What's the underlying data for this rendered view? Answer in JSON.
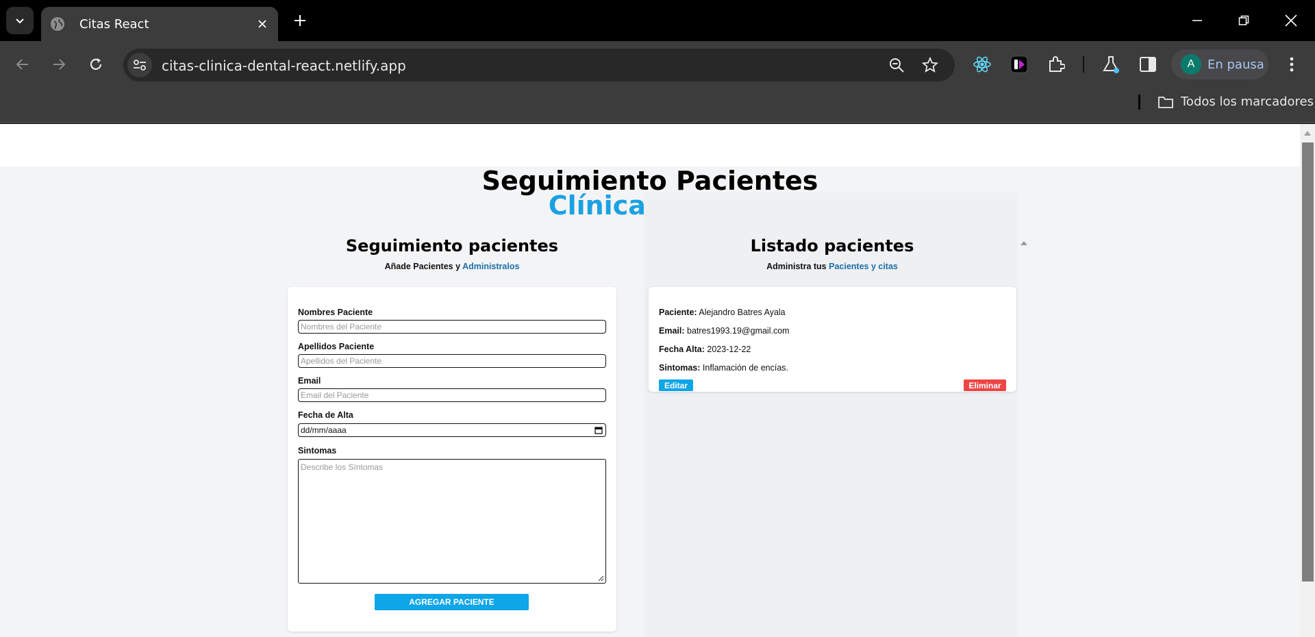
{
  "browser": {
    "tab_title": "Citas React",
    "url": "citas-clinica-dental-react.netlify.app",
    "profile_initial": "A",
    "profile_label": "En pausa",
    "bookmarks_folder": "Todos los marcadores"
  },
  "page": {
    "title_line1": "Seguimiento Pacientes",
    "title_line2": "Clínica Dental",
    "accent_color": "#1ba1e2",
    "form_section": {
      "title": "Seguimiento pacientes",
      "subtitle_prefix": "Añade Pacientes y ",
      "subtitle_accent": "Administralos",
      "fields": {
        "nombres": {
          "label": "Nombres Paciente",
          "placeholder": "Nombres del Paciente"
        },
        "apellidos": {
          "label": "Apellidos Paciente",
          "placeholder": "Apellidos del Paciente"
        },
        "email": {
          "label": "Email",
          "placeholder": "Email del Paciente"
        },
        "fecha": {
          "label": "Fecha de Alta",
          "value": "dd/mm/aaaa"
        },
        "sintomas": {
          "label": "Sintomas",
          "placeholder": "Describe los Síntomas"
        }
      },
      "submit_label": "AGREGAR PACIENTE"
    },
    "list_section": {
      "title": "Listado pacientes",
      "subtitle_prefix": "Administra tus ",
      "subtitle_accent": "Pacientes y citas",
      "patients": [
        {
          "paciente_label": "Paciente:",
          "paciente": "Alejandro Batres Ayala",
          "email_label": "Email:",
          "email": "batres1993.19@gmail.com",
          "fecha_label": "Fecha Alta:",
          "fecha": "2023-12-22",
          "sintomas_label": "Sintomas:",
          "sintomas": "Inflamación de encías.",
          "edit_label": "Editar",
          "delete_label": "Eliminar"
        }
      ]
    }
  }
}
